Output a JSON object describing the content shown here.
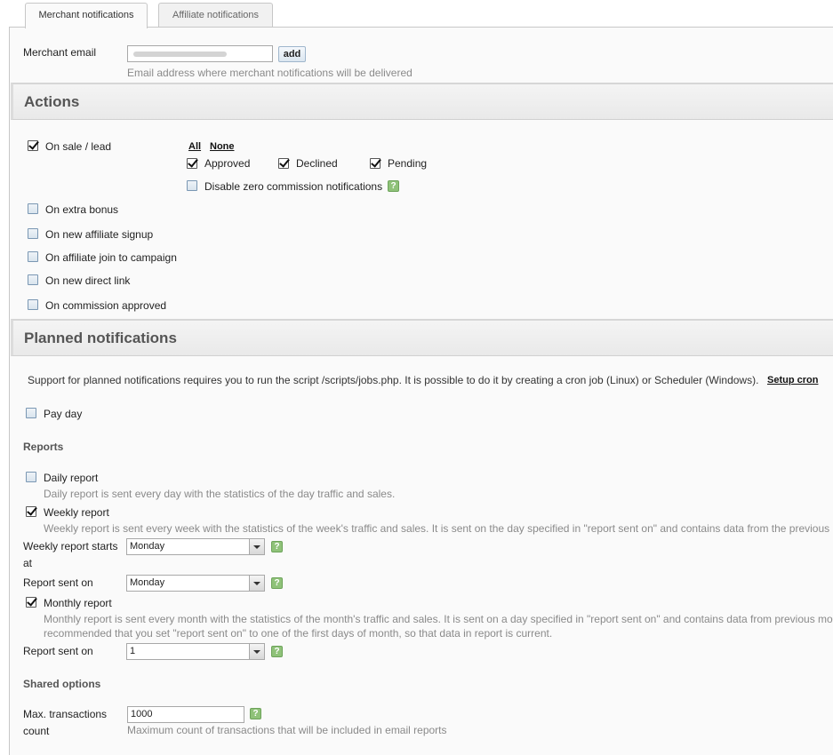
{
  "tabs": [
    {
      "label": "Merchant notifications",
      "active": true
    },
    {
      "label": "Affiliate notifications",
      "active": false
    }
  ],
  "merchant_email": {
    "label": "Merchant email",
    "value": "",
    "add_label": "add",
    "description": "Email address where merchant notifications will be delivered"
  },
  "actions": {
    "title": "Actions",
    "on_sale": {
      "label": "On sale / lead",
      "checked": true
    },
    "all_label": "All",
    "none_label": "None",
    "statuses": [
      {
        "label": "Approved",
        "checked": true
      },
      {
        "label": "Declined",
        "checked": true
      },
      {
        "label": "Pending",
        "checked": true
      }
    ],
    "disable_zero": {
      "label": "Disable zero commission notifications",
      "checked": false
    },
    "items": [
      {
        "label": "On extra bonus",
        "checked": false
      },
      {
        "label": "On new affiliate signup",
        "checked": false
      },
      {
        "label": "On affiliate join to campaign",
        "checked": false
      },
      {
        "label": "On new direct link",
        "checked": false
      },
      {
        "label": "On commission approved",
        "checked": false
      }
    ]
  },
  "planned": {
    "title": "Planned notifications",
    "support_text": "Support for planned notifications requires you to run the script /scripts/jobs.php. It is possible to do it by creating a cron job (Linux) or Scheduler (Windows).",
    "setup_cron": "Setup cron",
    "pay_day": {
      "label": "Pay day",
      "checked": false
    },
    "reports_heading": "Reports",
    "daily": {
      "label": "Daily report",
      "checked": false,
      "description": "Daily report is sent every day with the statistics of the day traffic and sales."
    },
    "weekly": {
      "label": "Weekly report",
      "checked": true,
      "description": "Weekly report is sent every week with the statistics of the week's traffic and sales. It is sent on the day specified in \"report sent on\" and contains data from the previous"
    },
    "weekly_starts_label_1": "Weekly report starts",
    "weekly_starts_label_2": "at",
    "weekly_starts_value": "Monday",
    "weekly_sent_on_label": "Report sent on",
    "weekly_sent_on_value": "Monday",
    "monthly": {
      "label": "Monthly report",
      "checked": true,
      "description_1": "Monthly report is sent every month with the statistics of the month's traffic and sales. It is sent on a day specified in \"report sent on\" and contains data from previous mo",
      "description_2": "recommended that you set \"report sent on\" to one of the first days of month, so that data in report is current."
    },
    "monthly_sent_on_label": "Report sent on",
    "monthly_sent_on_value": "1",
    "shared_heading": "Shared options",
    "max_tx_label_1": "Max. transactions",
    "max_tx_label_2": "count",
    "max_tx_value": "1000",
    "max_tx_description": "Maximum count of transactions that will be included in email reports"
  },
  "help_glyph": "?"
}
